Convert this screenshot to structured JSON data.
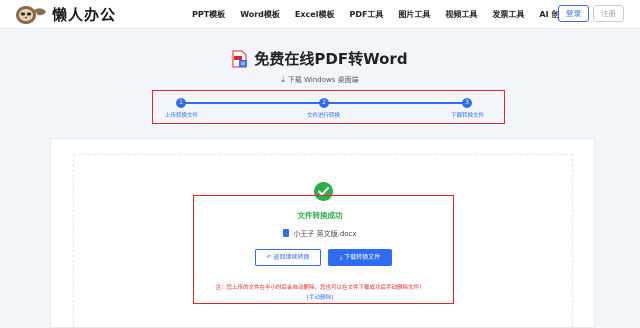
{
  "brand": {
    "name": "懒人办公"
  },
  "nav": {
    "items": [
      "PPT模板",
      "Word模板",
      "Excel模板",
      "PDF工具",
      "图片工具",
      "视频工具",
      "发票工具",
      "AI 创作"
    ]
  },
  "auth": {
    "login_label": "登录",
    "register_label": "注册"
  },
  "page": {
    "title": "免费在线PDF转Word",
    "download_link": "下载 Windows 桌面端"
  },
  "steps": [
    {
      "num": "1",
      "label": "上传转换文件"
    },
    {
      "num": "2",
      "label": "文件进行转换"
    },
    {
      "num": "3",
      "label": "下载转换文件"
    }
  ],
  "result": {
    "status": "文件转换成功",
    "file_name": "小王子 英文版.docx",
    "back_label": "返回继续转换",
    "download_label": "下载转换文件",
    "note": "注：您上传的文件在半小时后会自动删除，您也可以在文件下载成功后手动删除文件！",
    "manual_delete_label": "[手动删除]"
  },
  "colors": {
    "accent": "#2f6cf2",
    "success": "#2fae4b",
    "highlight": "#e0262a"
  }
}
